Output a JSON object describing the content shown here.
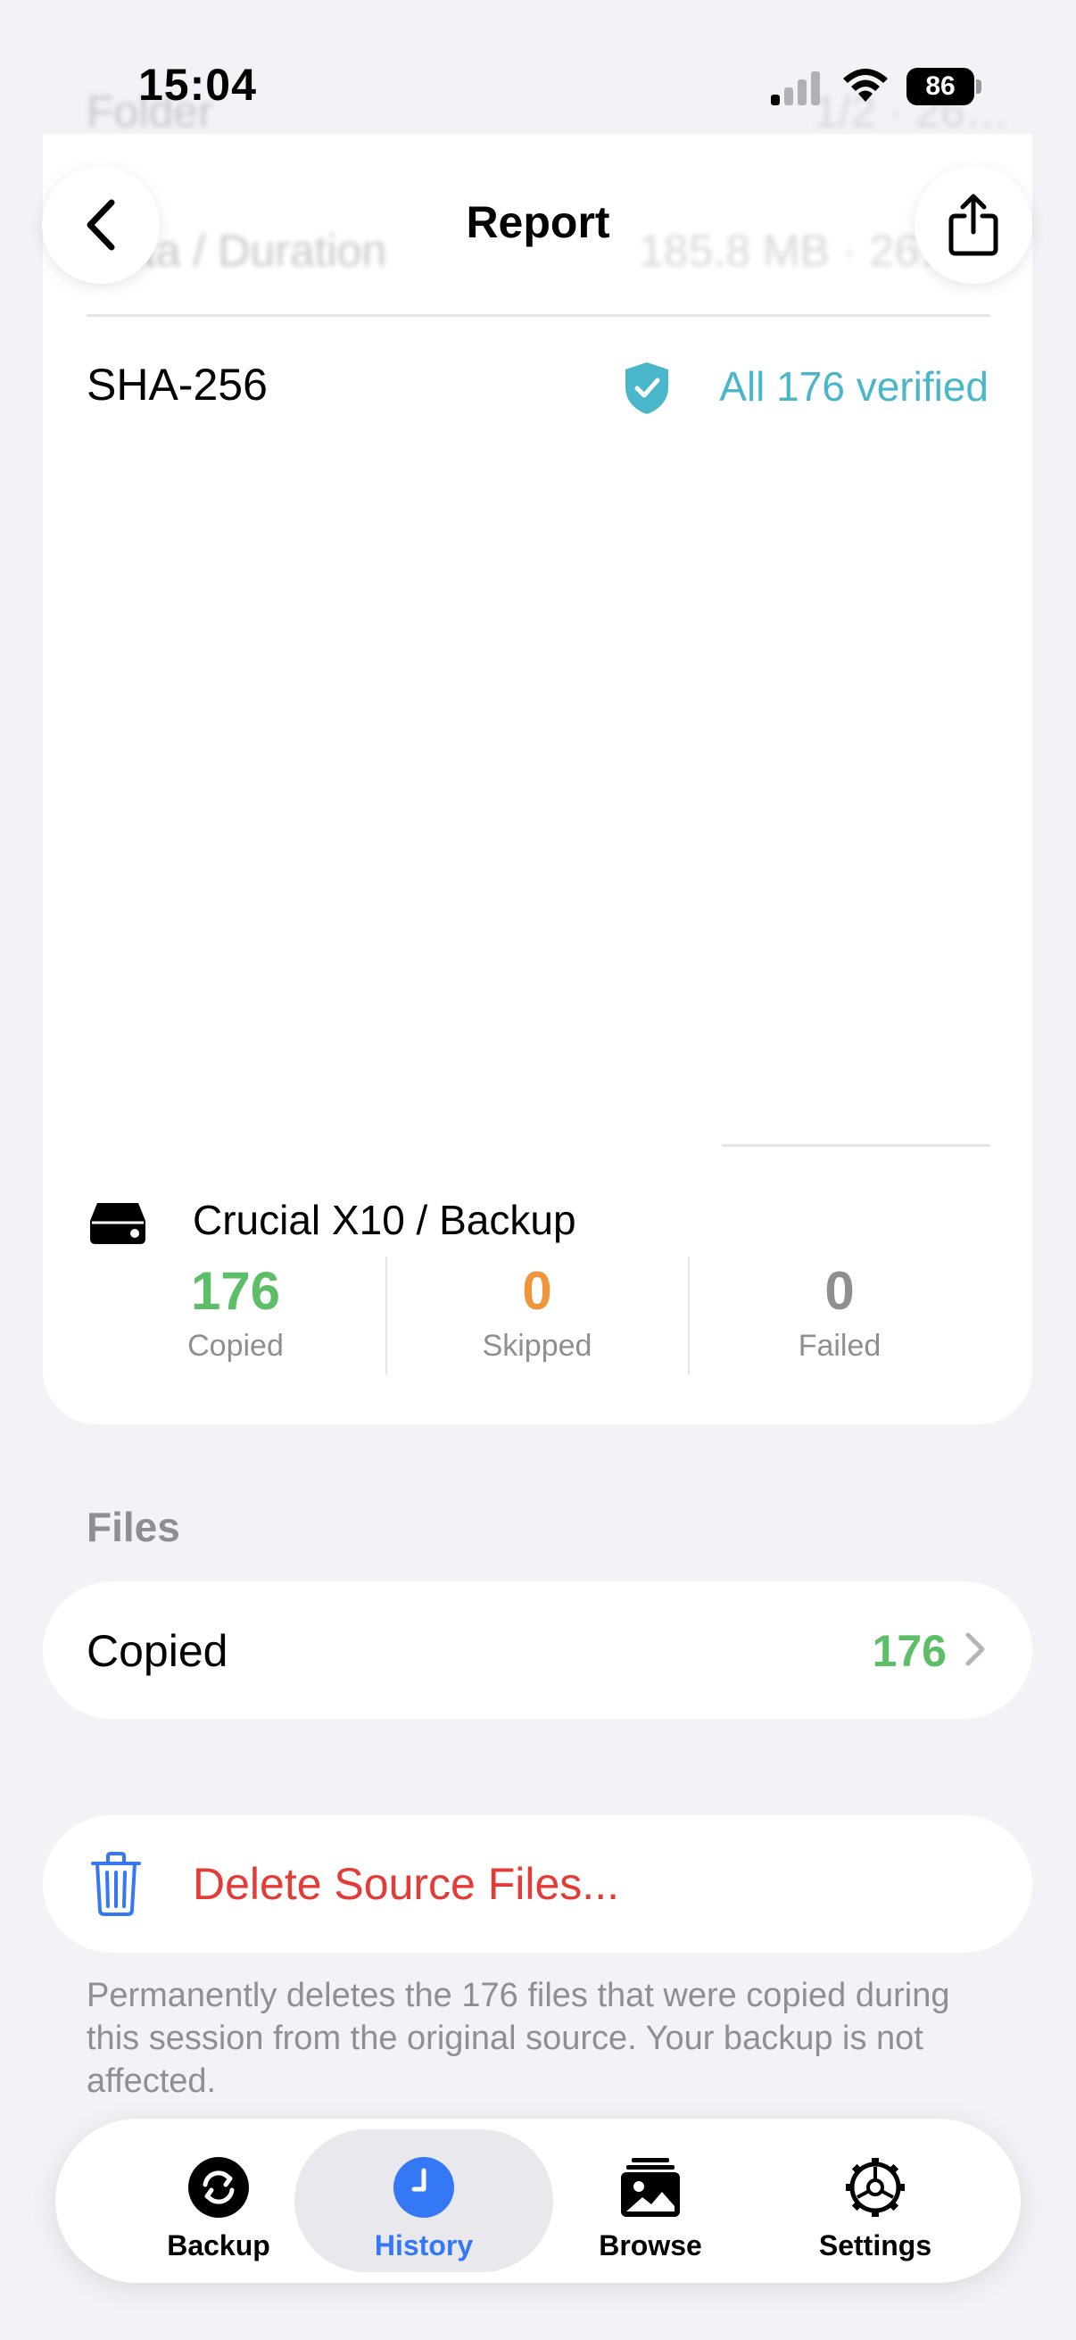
{
  "status_bar": {
    "time": "15:04",
    "battery": "86"
  },
  "background_rows": {
    "row1_label": "Folder",
    "row1_value": "1/2 · 26…",
    "row2_label": "Data / Duration",
    "row2_value": "185.8 MB · 26…"
  },
  "nav": {
    "title": "Report"
  },
  "report": {
    "hash_algorithm": "SHA-256",
    "verification_text": "All 176 verified",
    "destination": "Crucial X10 / Backup",
    "stats": [
      {
        "value": "176",
        "label": "Copied",
        "color": "#5cbe66"
      },
      {
        "value": "0",
        "label": "Skipped",
        "color": "#f0953a"
      },
      {
        "value": "0",
        "label": "Failed",
        "color": "#8e8e93"
      }
    ]
  },
  "files": {
    "header": "Files",
    "copied_label": "Copied",
    "copied_count": "176"
  },
  "delete": {
    "label": "Delete Source Files...",
    "footnote": "Permanently deletes the 176 files that were copied during this session from the original source. Your backup is not affected."
  },
  "tabs": [
    {
      "label": "Backup",
      "icon": "backup-sync-icon",
      "active": false
    },
    {
      "label": "History",
      "icon": "clock-icon",
      "active": true
    },
    {
      "label": "Browse",
      "icon": "photo-stack-icon",
      "active": false
    },
    {
      "label": "Settings",
      "icon": "gear-icon",
      "active": false
    }
  ],
  "colors": {
    "accent": "#3478f6",
    "verified": "#4ab6c9",
    "copied": "#5cbe66",
    "skipped": "#f0953a",
    "destructive": "#e53b36"
  }
}
